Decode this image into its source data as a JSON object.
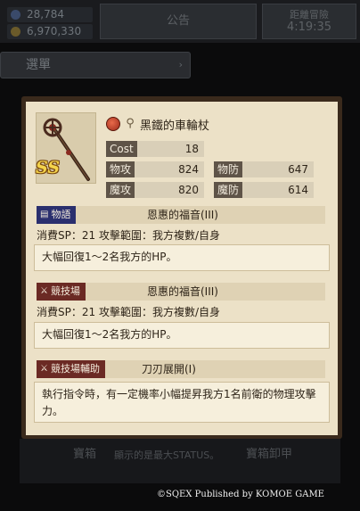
{
  "header": {
    "stamina": "28,784",
    "gold": "6,970,330",
    "center_label": "公告",
    "right_label": "距離冒險",
    "timer": "4:19:35"
  },
  "menu": {
    "label": "選單"
  },
  "weapon": {
    "rarity": "SS",
    "name": "黑鐵的車輪杖"
  },
  "stats": {
    "cost_label": "Cost",
    "cost": "18",
    "patk_label": "物攻",
    "patk": "824",
    "pdef_label": "物防",
    "pdef": "647",
    "matk_label": "魔攻",
    "matk": "820",
    "mdef_label": "魔防",
    "mdef": "614"
  },
  "skills": [
    {
      "tag": "物語",
      "tag_color": "#2a2f6e",
      "name": "恩惠的福音(III)",
      "sub": "消費SP：21 攻擊範圍：我方複數/自身",
      "desc": "大幅回復1～2名我方的HP。"
    },
    {
      "tag": "競技場",
      "tag_color": "#6b2a24",
      "name": "恩惠的福音(III)",
      "sub": "消費SP：21 攻擊範圍：我方複數/自身",
      "desc": "大幅回復1～2名我方的HP。"
    },
    {
      "tag": "競技場輔助",
      "tag_color": "#6b2a24",
      "name": "刀刃展開(I)",
      "desc": "執行指令時，有一定機率小幅提昇我方1名前衛的物理攻擊力。"
    }
  ],
  "footer": {
    "left_text": "寶箱",
    "mid_text": "顯示的是最大STATUS。",
    "right_text": "寶箱卸甲"
  },
  "copyright": "©SQEX Published by KOMOE GAME"
}
